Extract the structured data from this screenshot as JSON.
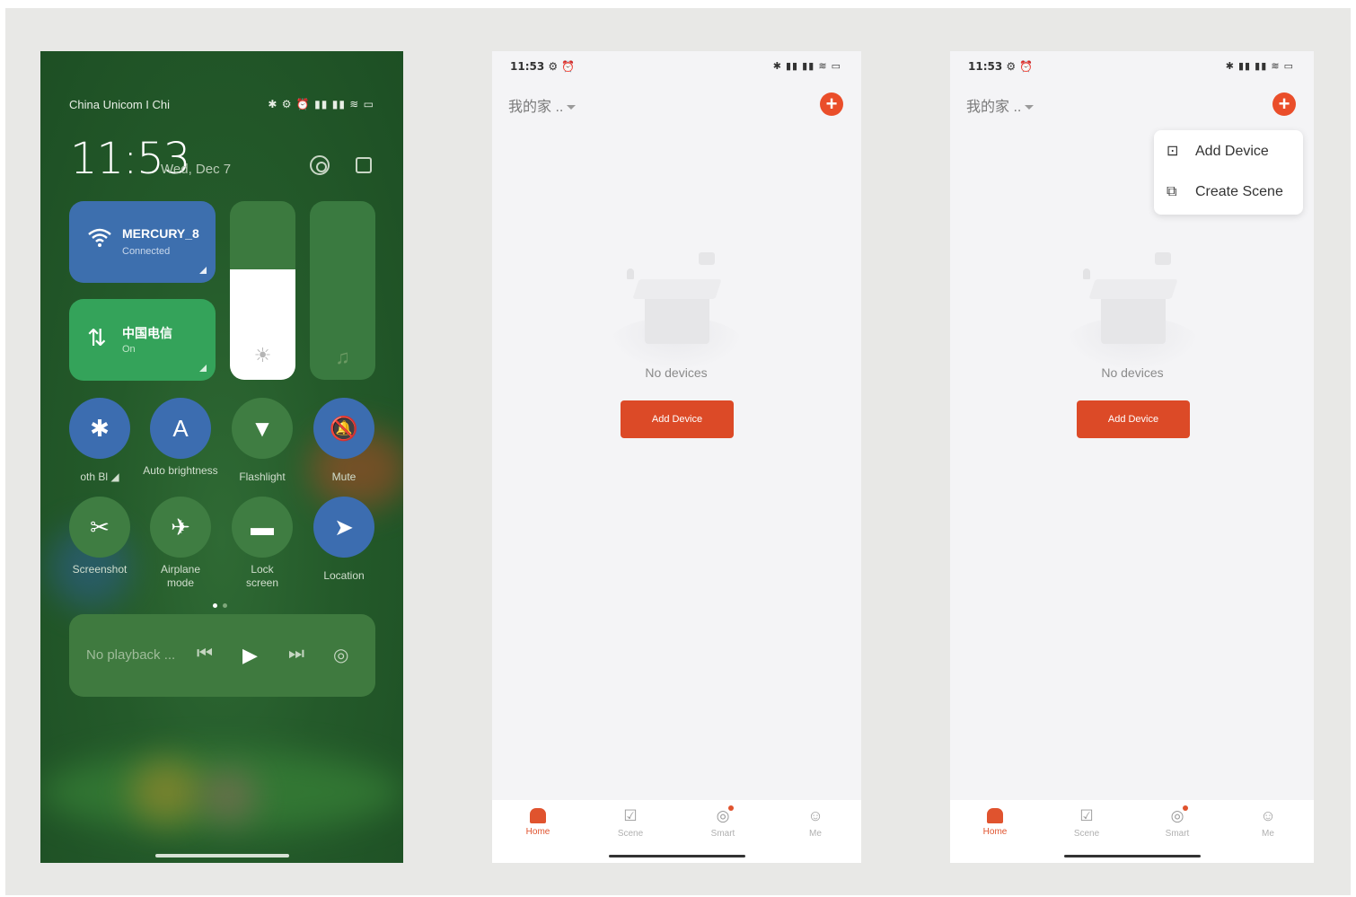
{
  "control_center": {
    "carrier": "China Unicom I Chi",
    "status_icons": "✱ ⚙ ⏰ ▮▮ ▮▮ ≋ ▭",
    "time": "11:53",
    "date": "Wed, Dec 7",
    "wifi_tile": {
      "name": "MERCURY_8",
      "status": "Connected",
      "icon": "wifi-icon"
    },
    "data_tile": {
      "name": "中国电信",
      "status": "On",
      "icon": "mobile-data-icon"
    },
    "brightness_level": 0.62,
    "volume_level": 0.0,
    "toggles": [
      {
        "label": "oth    Bl ◢",
        "glyph": "✱",
        "state": "on",
        "icon": "bluetooth-icon"
      },
      {
        "label": "Auto brightness",
        "glyph": "A",
        "state": "on",
        "icon": "auto-brightness-icon"
      },
      {
        "label": "Flashlight",
        "glyph": "▼",
        "state": "off",
        "icon": "flashlight-icon"
      },
      {
        "label": "Mute",
        "glyph": "🔕",
        "state": "on",
        "icon": "mute-icon"
      },
      {
        "label": "Screenshot",
        "glyph": "✂",
        "state": "off",
        "icon": "screenshot-icon"
      },
      {
        "label": "Airplane mode",
        "glyph": "✈",
        "state": "off",
        "icon": "airplane-icon"
      },
      {
        "label": "Lock screen",
        "glyph": "▬",
        "state": "off",
        "icon": "lock-icon"
      },
      {
        "label": "Location",
        "glyph": "➤",
        "state": "on",
        "icon": "location-icon"
      }
    ],
    "media": {
      "text": "No playback ...",
      "prev": "⏮",
      "play": "▶",
      "next": "⏭",
      "cast": "◎"
    }
  },
  "app_screens": [
    {
      "status_time": "11:53 ⚙ ⏰",
      "status_icons": "✱ ▮▮ ▮▮ ≋ ▭",
      "home_title": "我的家 ..",
      "empty_text": "No devices",
      "add_button": "Add Device",
      "tabs": [
        {
          "label": "Home",
          "icon": "home-icon",
          "active": true
        },
        {
          "label": "Scene",
          "icon": "scene-icon",
          "active": false
        },
        {
          "label": "Smart",
          "icon": "smart-icon",
          "active": false
        },
        {
          "label": "Me",
          "icon": "me-icon",
          "active": false
        }
      ]
    },
    {
      "status_time": "11:53 ⚙ ⏰",
      "status_icons": "✱ ▮▮ ▮▮ ≋ ▭",
      "home_title": "我的家 ..",
      "empty_text": "No devices",
      "add_button": "Add Device",
      "menu": [
        {
          "label": "Add Device",
          "icon": "add-device-icon"
        },
        {
          "label": "Create Scene",
          "icon": "create-scene-icon"
        }
      ],
      "tabs": [
        {
          "label": "Home",
          "icon": "home-icon",
          "active": true
        },
        {
          "label": "Scene",
          "icon": "scene-icon",
          "active": false
        },
        {
          "label": "Smart",
          "icon": "smart-icon",
          "active": false
        },
        {
          "label": "Me",
          "icon": "me-icon",
          "active": false
        }
      ]
    }
  ],
  "colors": {
    "accent": "#dc4a27",
    "cc_blue": "#3c6db0",
    "cc_green": "#34a35a",
    "cc_bg": "#245a2a"
  }
}
